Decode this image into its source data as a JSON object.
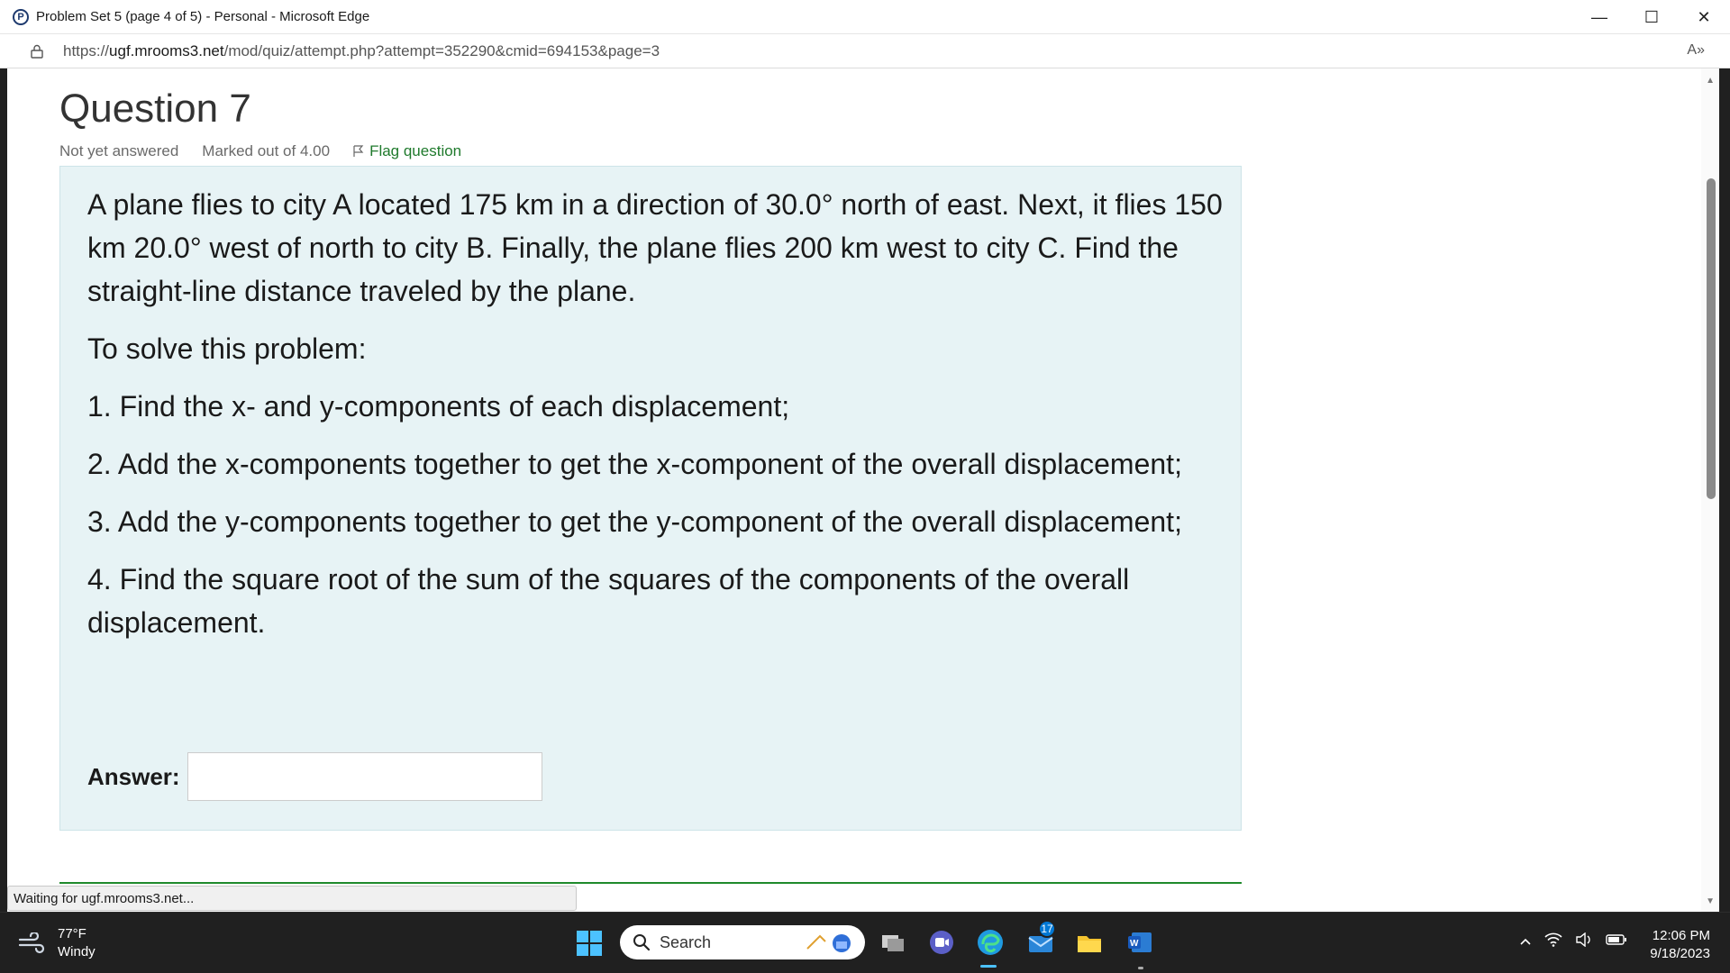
{
  "window": {
    "title": "Problem Set 5 (page 4 of 5) - Personal - Microsoft Edge",
    "app_icon_letter": "P",
    "minimize": "—",
    "maximize": "☐",
    "close": "✕"
  },
  "address": {
    "url_prefix": "https://",
    "url_host": "ugf.mrooms3.net",
    "url_path": "/mod/quiz/attempt.php?attempt=352290&cmid=694153&page=3",
    "read_aloud": "A»"
  },
  "question": {
    "title": "Question 7",
    "status": "Not yet answered",
    "marks": "Marked out of 4.00",
    "flag_label": "Flag question",
    "paragraphs": [
      "A plane flies to city A located 175 km in a direction of 30.0° north of east. Next, it flies 150 km 20.0° west of north to city B. Finally, the plane flies 200 km west to city C. Find the straight-line distance traveled by the plane.",
      "To solve this problem:",
      "1. Find the x- and y-components of each displacement;",
      "2. Add the x-components together to get the x-component of the overall displacement;",
      "3. Add the y-components together to get the y-component of the overall displacement;",
      "4. Find the square root of the sum of the squares of the components of the overall displacement."
    ],
    "answer_label": "Answer:",
    "answer_value": ""
  },
  "status_bar": "Waiting for ugf.mrooms3.net...",
  "taskbar": {
    "weather_temp": "77°F",
    "weather_desc": "Windy",
    "search_placeholder": "Search",
    "mail_badge": "17",
    "time": "12:06 PM",
    "date": "9/18/2023"
  },
  "colors": {
    "question_bg": "#e7f3f5",
    "flag_green": "#1f7a2c",
    "taskbar_bg": "#202020",
    "accent": "#4cc2ff"
  }
}
